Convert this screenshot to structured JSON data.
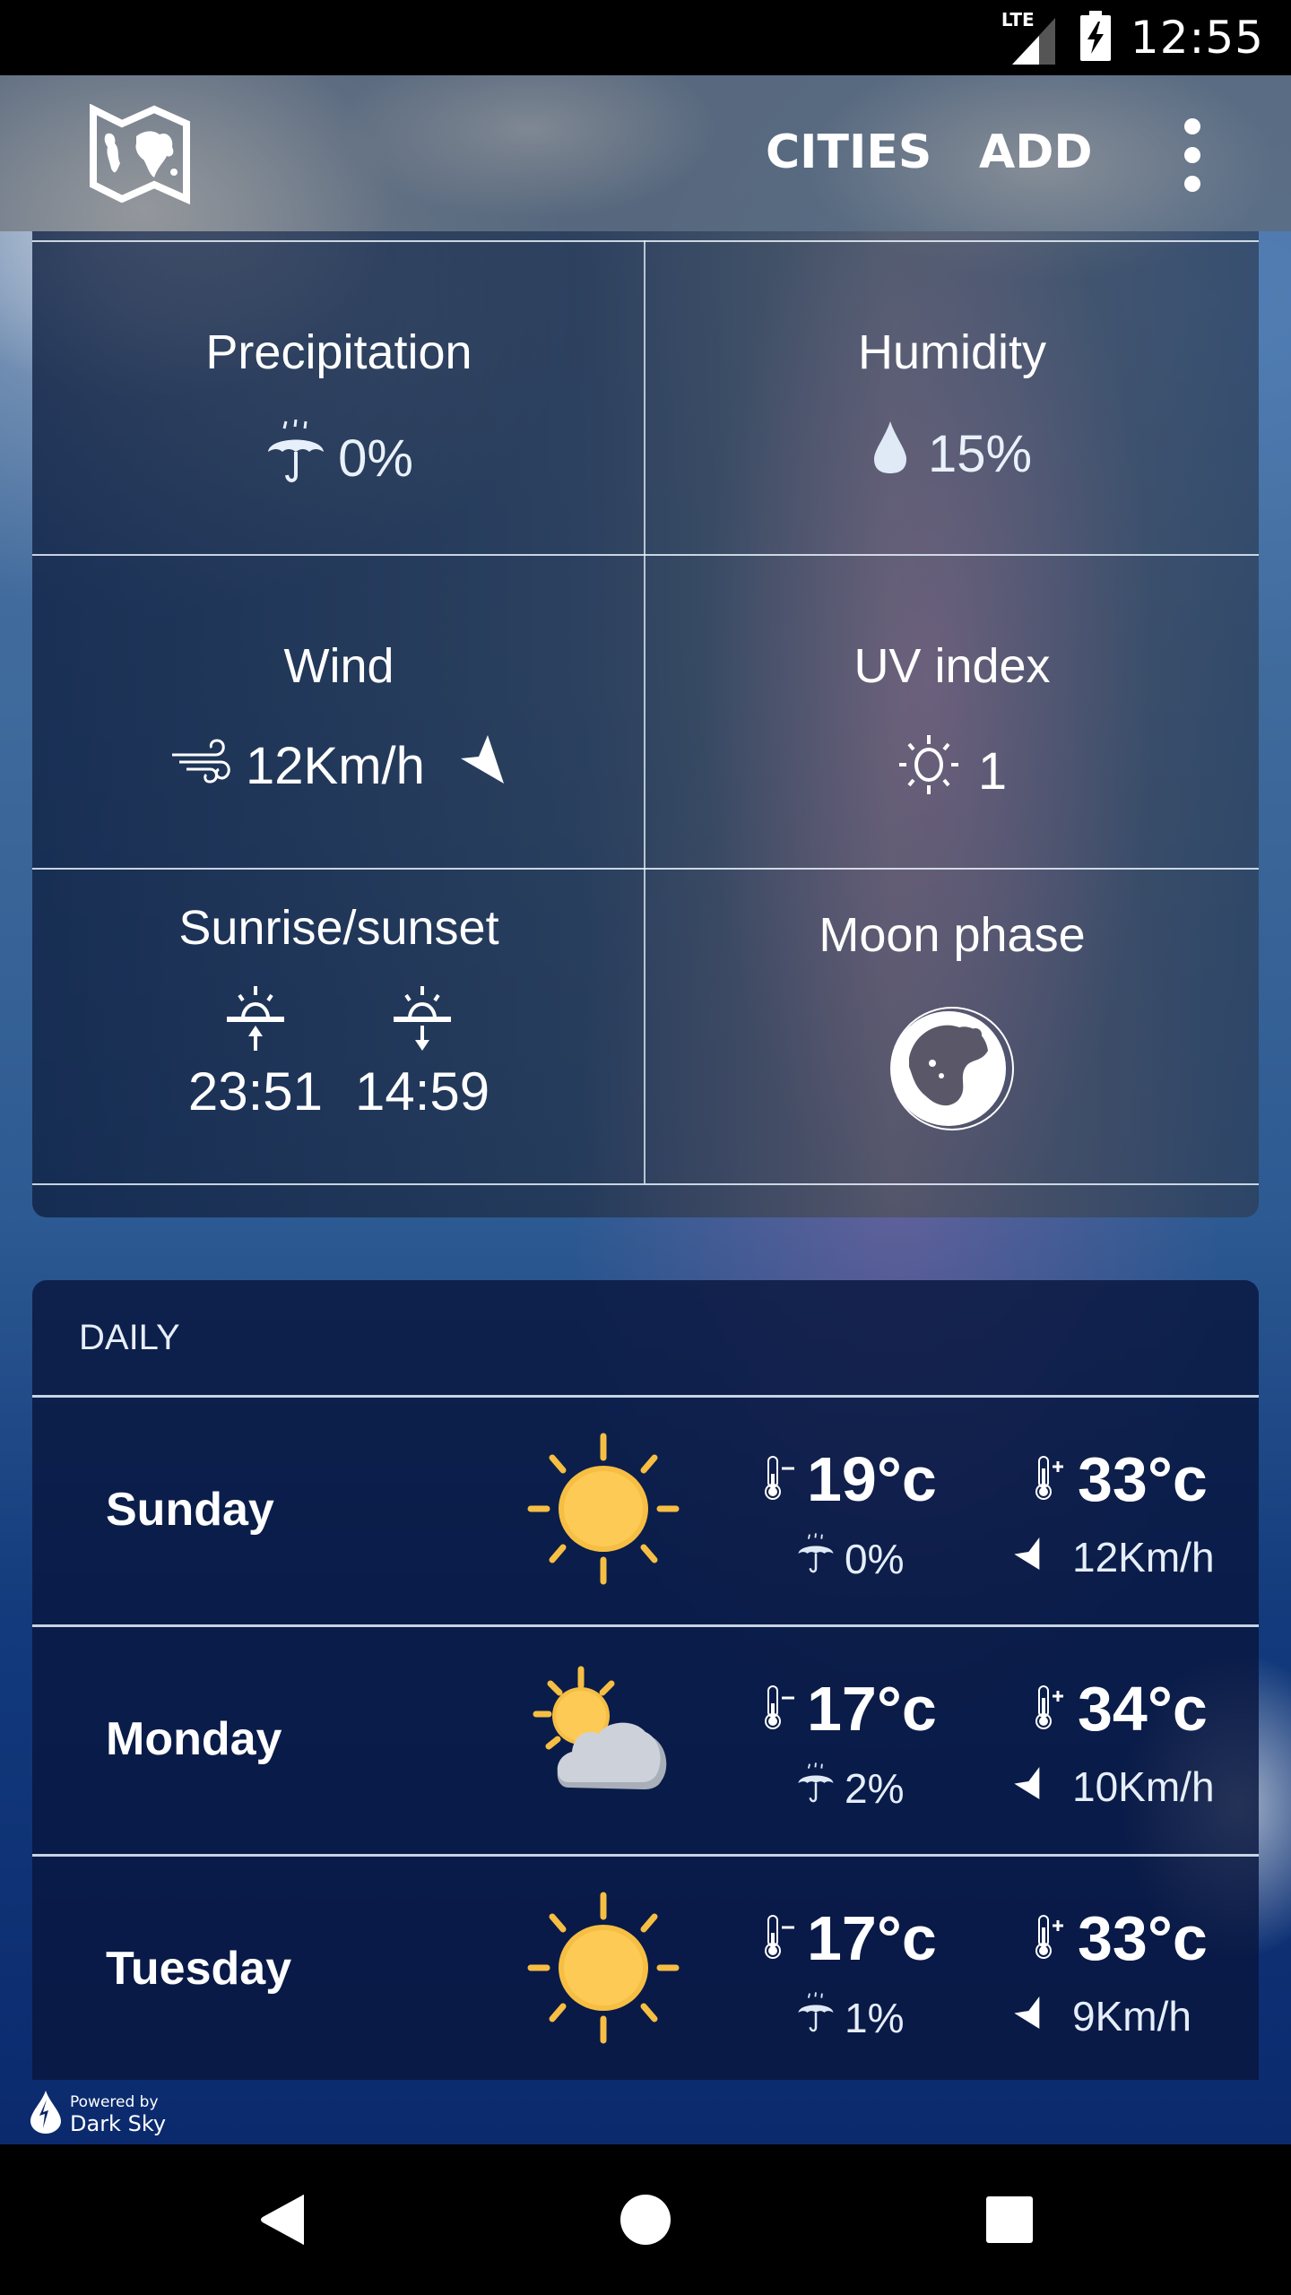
{
  "status_bar": {
    "network": "LTE",
    "time": "12:55",
    "icons": [
      "lte-signal-icon",
      "battery-charging-icon"
    ]
  },
  "app_bar": {
    "logo_icon": "world-map-icon",
    "actions": [
      {
        "label": "CITIES"
      },
      {
        "label": "ADD"
      }
    ],
    "overflow_icon": "more-vert-icon"
  },
  "details": {
    "precipitation": {
      "title": "Precipitation",
      "value": "0%",
      "icon": "umbrella-rain-icon"
    },
    "humidity": {
      "title": "Humidity",
      "value": "15%",
      "icon": "water-drop-icon"
    },
    "wind": {
      "title": "Wind",
      "value": "12Km/h",
      "icon": "wind-icon",
      "direction_icon": "wind-direction-arrow-icon"
    },
    "uv": {
      "title": "UV index",
      "value": "1",
      "icon": "sun-outline-icon"
    },
    "sun": {
      "title": "Sunrise/sunset",
      "sunrise": "23:51",
      "sunset": "14:59",
      "sunrise_icon": "sunrise-icon",
      "sunset_icon": "sunset-icon"
    },
    "moon": {
      "title": "Moon phase",
      "icon": "moon-phase-waning-gibbous-icon"
    }
  },
  "daily": {
    "header": "DAILY",
    "days": [
      {
        "name": "Sunday",
        "condition": "clear-day",
        "min": "19°c",
        "max": "33°c",
        "precip": "0%",
        "wind": "12Km/h"
      },
      {
        "name": "Monday",
        "condition": "partly-cloudy-day",
        "min": "17°c",
        "max": "34°c",
        "precip": "2%",
        "wind": "10Km/h"
      },
      {
        "name": "Tuesday",
        "condition": "clear-day",
        "min": "17°c",
        "max": "33°c",
        "precip": "1%",
        "wind": "9Km/h"
      }
    ]
  },
  "footer": {
    "powered_by": "Powered by",
    "provider": "Dark Sky"
  },
  "colors": {
    "sun_yellow": "#FDCB55",
    "sun_ray": "#F6BE43",
    "cloud_gray": "#CDD2DA",
    "daily_card_bg": "#0A1A45",
    "status_bar_bg": "#000000"
  }
}
